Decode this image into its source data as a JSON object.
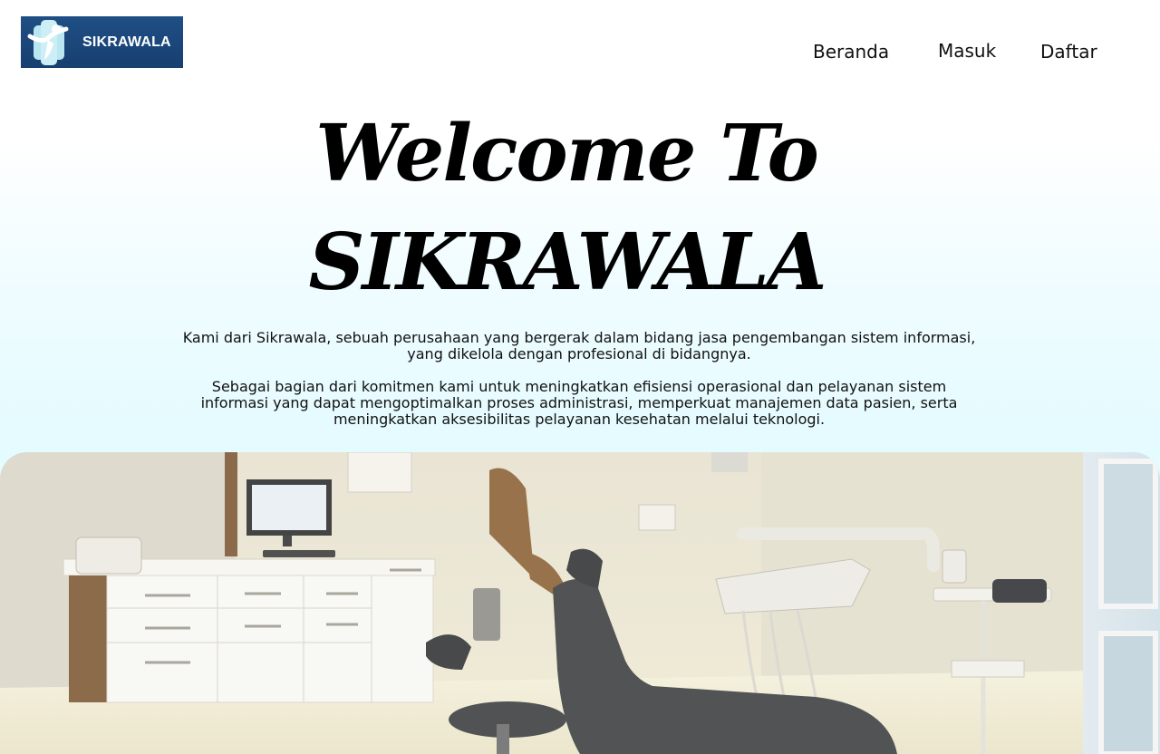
{
  "header": {
    "logo_text": "SIKRAWALA",
    "logo_bg": "#1f4f86"
  },
  "nav": {
    "beranda": "Beranda",
    "masuk": "Masuk",
    "daftar": "Daftar"
  },
  "hero": {
    "title_line1": "Welcome To",
    "title_line2": "SIKRAWALA",
    "paragraph1": "Kami dari Sikrawala, sebuah perusahaan yang bergerak dalam bidang jasa pengembangan sistem informasi, yang dikelola dengan profesional di bidangnya.",
    "paragraph2": "Sebagai bagian dari komitmen kami untuk meningkatkan efisiensi operasional dan pelayanan sistem informasi yang dapat mengoptimalkan proses administrasi, memperkuat manajemen data pasien, serta meningkatkan aksesibilitas pelayanan kesehatan melalui teknologi."
  },
  "colors": {
    "background_top": "#ffffff",
    "background_bottom": "#e4fbff",
    "text": "#000000"
  },
  "image": {
    "subject": "dental clinic room with dental chair, cabinets and monitor"
  }
}
